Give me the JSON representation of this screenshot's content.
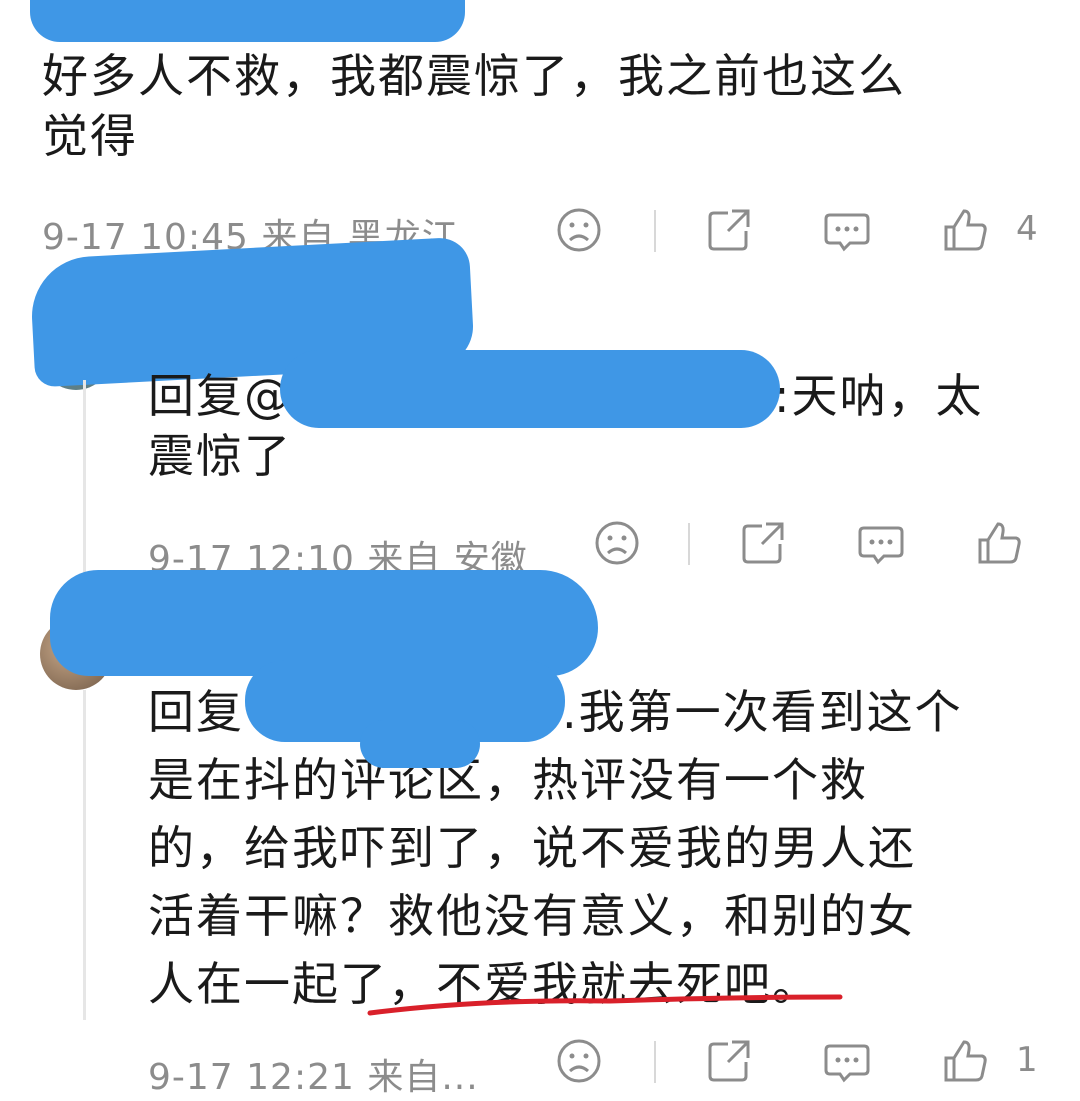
{
  "comments": [
    {
      "text": "好多人不救，我都震惊了，我之前也这么觉得",
      "text_line1": "好多人不救，我都震惊了，我之前也这么",
      "text_line2": "觉得",
      "meta": "9-17 10:45 来自 黑龙江",
      "like_count": "4"
    },
    {
      "reply_prefix": "回复@",
      "reply_suffix": ":天呐，太",
      "text_line2": "震惊了",
      "meta": "9-17 12:10 来自 安徽",
      "like_count": ""
    },
    {
      "reply_prefix": "回复",
      "line1_tail": ".我第一次看到这个",
      "line2": "是在抖的评论区，热评没有一个救",
      "line3": "的，给我吓到了，说不爱我的男人还",
      "line4": "活着干嘛？救他没有意义，和别的女",
      "line5": "人在一起了，不爱我就去死吧。",
      "meta": "9-17 12:21 来自...",
      "like_count": "1"
    }
  ],
  "colors": {
    "redaction": "#3f97e6",
    "underline": "#d9202a",
    "meta_text": "#8c8c8c"
  },
  "icons": [
    "sad-face-icon",
    "share-icon",
    "comment-icon",
    "like-icon"
  ]
}
